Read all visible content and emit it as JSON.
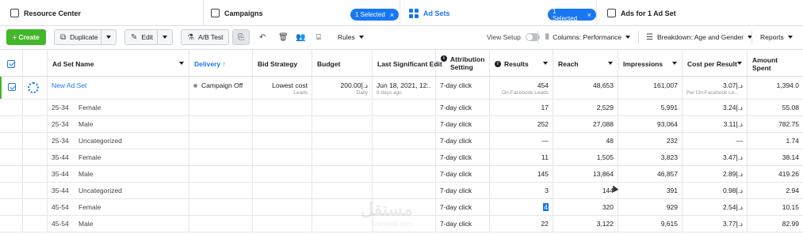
{
  "nav": {
    "resource_center": "Resource Center",
    "campaigns": "Campaigns",
    "campaigns_selected": "1 Selected",
    "ad_sets": "Ad Sets",
    "ad_sets_selected": "1 Selected",
    "ads": "Ads for 1 Ad Set"
  },
  "toolbar": {
    "create": "+ Create",
    "duplicate": "Duplicate",
    "edit": "Edit",
    "ab_test": "A/B Test",
    "rules": "Rules",
    "view_setup": "View Setup",
    "columns": "Columns: Performance",
    "breakdown": "Breakdown: Age and Gender",
    "reports": "Reports"
  },
  "columns": {
    "name": "Ad Set Name",
    "delivery": "Delivery ↑",
    "bid": "Bid Strategy",
    "budget": "Budget",
    "last_edit": "Last Significant Edit",
    "attribution": "Attribution Setting",
    "results": "Results",
    "reach": "Reach",
    "impressions": "Impressions",
    "cost_per_result": "Cost per Result",
    "amount_spent": "Amount Spent"
  },
  "main_row": {
    "name": "New Ad Set",
    "delivery": "Campaign Off",
    "bid": "Lowest cost",
    "bid_sub": "Leads",
    "budget": "200.00د.إ",
    "budget_sub": "Daily",
    "last_edit": "Jun 18, 2021, 12:...",
    "last_edit_sub": "9 days ago",
    "attribution": "7-day click",
    "results": "454",
    "results_sub": "On-Facebook Leads",
    "reach": "48,653",
    "impressions": "161,007",
    "cpr": "3.07د.إ",
    "cpr_sub": "Per On-Facebook Le...",
    "spent": "1,394.0"
  },
  "rows": [
    {
      "age": "25-34",
      "gender": "Female",
      "attribution": "7-day click",
      "results": "17",
      "reach": "2,529",
      "impressions": "5,991",
      "cpr": "3.24د.إ",
      "spent": "55.08"
    },
    {
      "age": "25-34",
      "gender": "Male",
      "attribution": "7-day click",
      "results": "252",
      "reach": "27,088",
      "impressions": "93,064",
      "cpr": "3.11د.إ",
      "spent": "782.75"
    },
    {
      "age": "25-34",
      "gender": "Uncategorized",
      "attribution": "7-day click",
      "results": "—",
      "reach": "48",
      "impressions": "232",
      "cpr": "—",
      "spent": "1.74"
    },
    {
      "age": "35-44",
      "gender": "Female",
      "attribution": "7-day click",
      "results": "11",
      "reach": "1,505",
      "impressions": "3,823",
      "cpr": "3.47د.إ",
      "spent": "38.14"
    },
    {
      "age": "35-44",
      "gender": "Male",
      "attribution": "7-day click",
      "results": "145",
      "reach": "13,864",
      "impressions": "46,857",
      "cpr": "2.89د.إ",
      "spent": "419.26"
    },
    {
      "age": "35-44",
      "gender": "Uncategorized",
      "attribution": "7-day click",
      "results": "3",
      "reach": "144",
      "impressions": "391",
      "cpr": "0.98د.إ",
      "spent": "2.94"
    },
    {
      "age": "45-54",
      "gender": "Female",
      "attribution": "7-day click",
      "results": "4",
      "reach": "320",
      "impressions": "929",
      "cpr": "2.54د.إ",
      "spent": "10.15"
    },
    {
      "age": "45-54",
      "gender": "Male",
      "attribution": "7-day click",
      "results": "22",
      "reach": "3,122",
      "impressions": "9,615",
      "cpr": "3.77د.إ",
      "spent": "82.99"
    }
  ],
  "watermark": {
    "arabic": "مستقل",
    "latin": "mostaql.com"
  },
  "colors": {
    "accent": "#1877f2",
    "create": "#42b72a"
  }
}
